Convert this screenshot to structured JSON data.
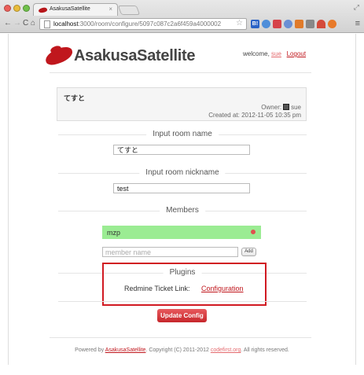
{
  "browser": {
    "tab_title": "AsakusaSatellite",
    "tab_close": "×",
    "url_host": "localhost",
    "url_path": ":3000/room/configure/5097c087c2a6f459a4000002",
    "extensions": [
      {
        "name": "B!",
        "color": "#2b63c6"
      },
      {
        "name": "",
        "color": "#4f8ed9"
      },
      {
        "name": "",
        "color": "#d6434a"
      },
      {
        "name": "",
        "color": "#6a8fd4"
      },
      {
        "name": "",
        "color": "#e07b2a"
      },
      {
        "name": "",
        "color": "#888888"
      },
      {
        "name": "",
        "color": "#d44a3a"
      },
      {
        "name": "",
        "color": "#e87a2a"
      }
    ]
  },
  "header": {
    "logo_text": "AsakusaSatellite",
    "welcome_prefix": "welcome,",
    "username": "sue",
    "logout": "Logout"
  },
  "room": {
    "name": "てすと",
    "owner_label": "Owner:",
    "owner_name": "sue",
    "created": "Created at: 2012-11-05 10:35 pm"
  },
  "sections": {
    "room_name_legend": "Input room name",
    "room_name_value": "てすと",
    "nickname_legend": "Input room nickname",
    "nickname_value": "test",
    "members_legend": "Members",
    "member_name": "mzp",
    "member_placeholder": "member name",
    "add_label": "Add",
    "plugins_legend": "Plugins",
    "plugin_label": "Redmine Ticket Link:",
    "plugin_link": "Configuration",
    "update_label": "Update Config"
  },
  "footer": {
    "powered_by": "Powered by",
    "app_link": "AsakusaSatellite",
    "copyright": ". Copyright (C) 2011-2012",
    "company_link": "codefirst.org",
    "rights": ". All rights reserved."
  },
  "colors": {
    "brand": "#c0171d",
    "member_bg": "#9bec93",
    "highlight": "#d11a22"
  }
}
